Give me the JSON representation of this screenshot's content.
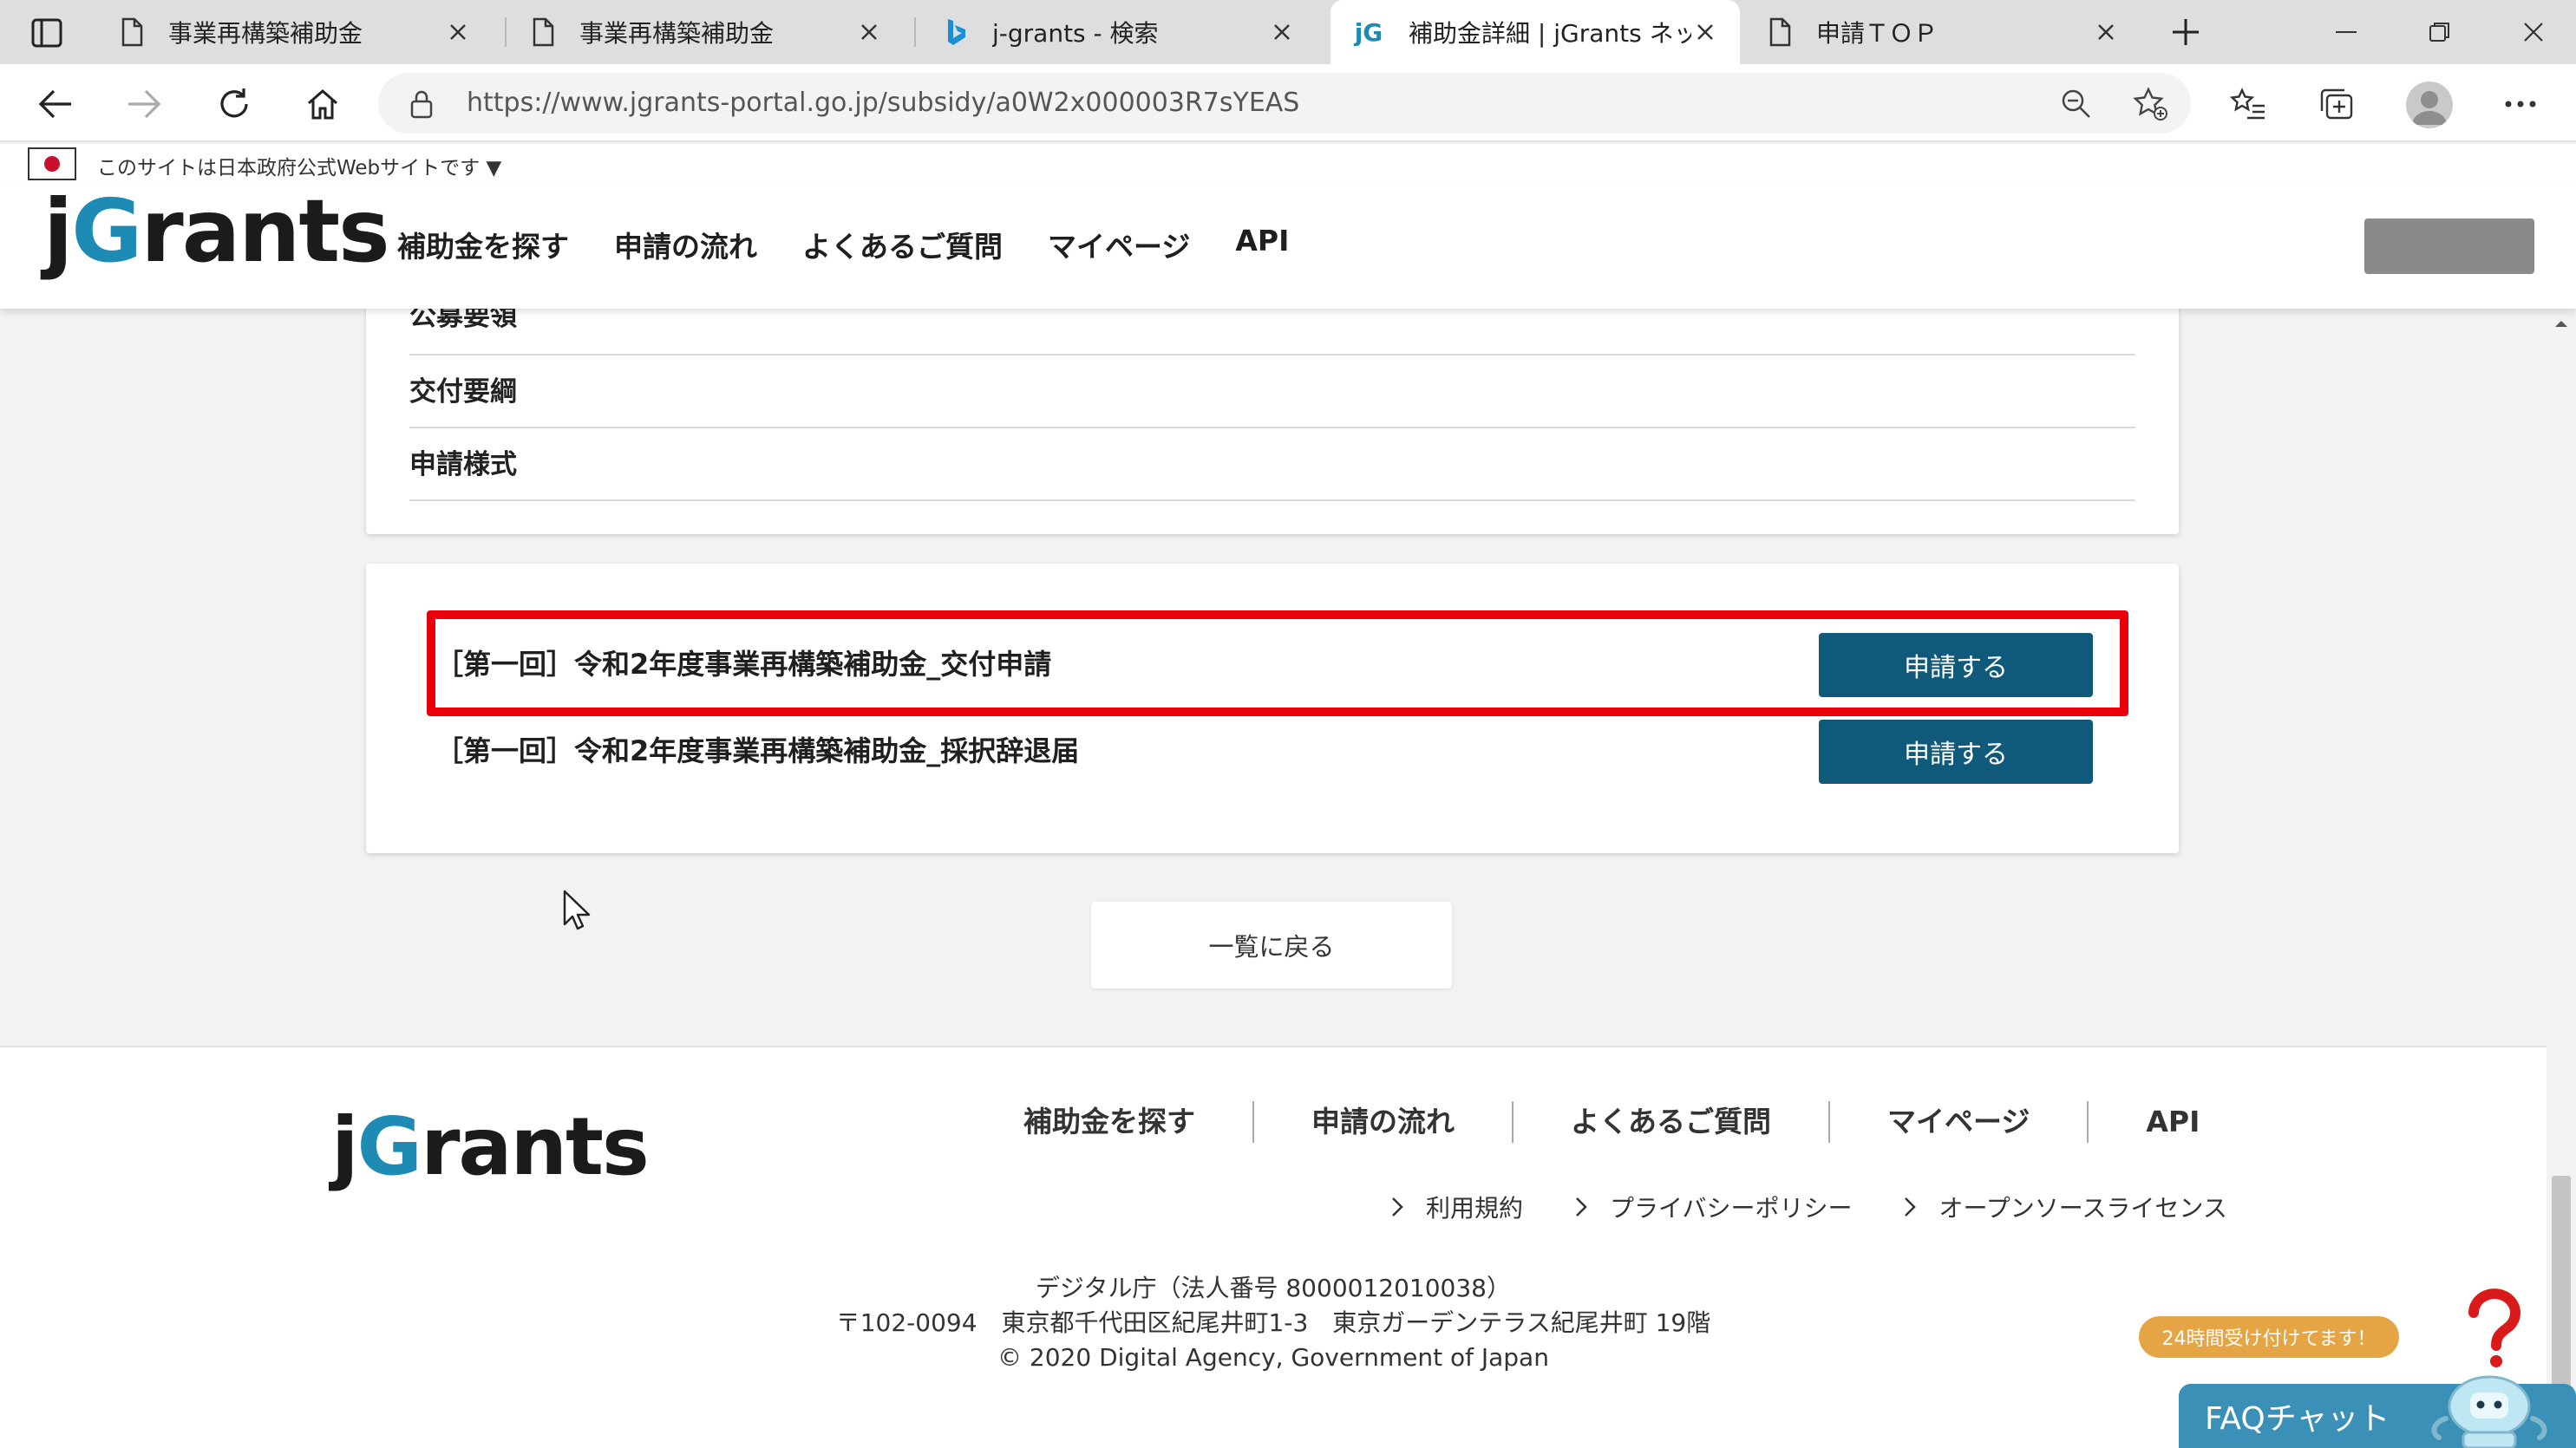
{
  "browser": {
    "tabs": [
      {
        "title": "事業再構築補助金",
        "icon": "page-icon",
        "active": false
      },
      {
        "title": "事業再構築補助金",
        "icon": "page-icon",
        "active": false
      },
      {
        "title": "j-grants - 検索",
        "icon": "bing-icon",
        "active": false
      },
      {
        "title": "補助金詳細 | jGrants ネット",
        "icon": "jgrants-favicon",
        "active": true
      },
      {
        "title": "申請ＴＯＰ",
        "icon": "page-icon",
        "active": false
      }
    ],
    "url": "https://www.jgrants-portal.go.jp/subsidy/a0W2x000003R7sYEAS"
  },
  "gov_banner": {
    "text": "このサイトは日本政府公式Webサイトです ▼"
  },
  "logo": {
    "j": "j",
    "g": "G",
    "rest": "rants"
  },
  "header": {
    "nav": [
      "補助金を探す",
      "申請の流れ",
      "よくあるご質問",
      "マイページ",
      "API"
    ]
  },
  "documents": {
    "items": [
      "公募要領",
      "交付要綱",
      "申請様式"
    ]
  },
  "applications": [
    {
      "label": "［第一回］令和2年度事業再構築補助金_交付申請",
      "button": "申請する"
    },
    {
      "label": "［第一回］令和2年度事業再構築補助金_採択辞退届",
      "button": "申請する"
    }
  ],
  "back_button": "一覧に戻る",
  "footer": {
    "nav": [
      "補助金を探す",
      "申請の流れ",
      "よくあるご質問",
      "マイページ",
      "API"
    ],
    "links": [
      "利用規約",
      "プライバシーポリシー",
      "オープンソースライセンス"
    ],
    "org": "デジタル庁（法人番号 8000012010038）",
    "address": "〒102-0094　東京都千代田区紀尾井町1-3　東京ガーデンテラス紀尾井町 19階",
    "copyright": "© 2020 Digital Agency, Government of Japan"
  },
  "chat": {
    "bubble": "24時間受け付けてます！",
    "label": "FAQチャット"
  },
  "colors": {
    "brand_blue": "#1e8bb5",
    "button_blue": "#0f5a7b",
    "highlight_red": "#e8000b",
    "chat_blue": "#3a90b6",
    "chat_orange": "#e6a544"
  }
}
